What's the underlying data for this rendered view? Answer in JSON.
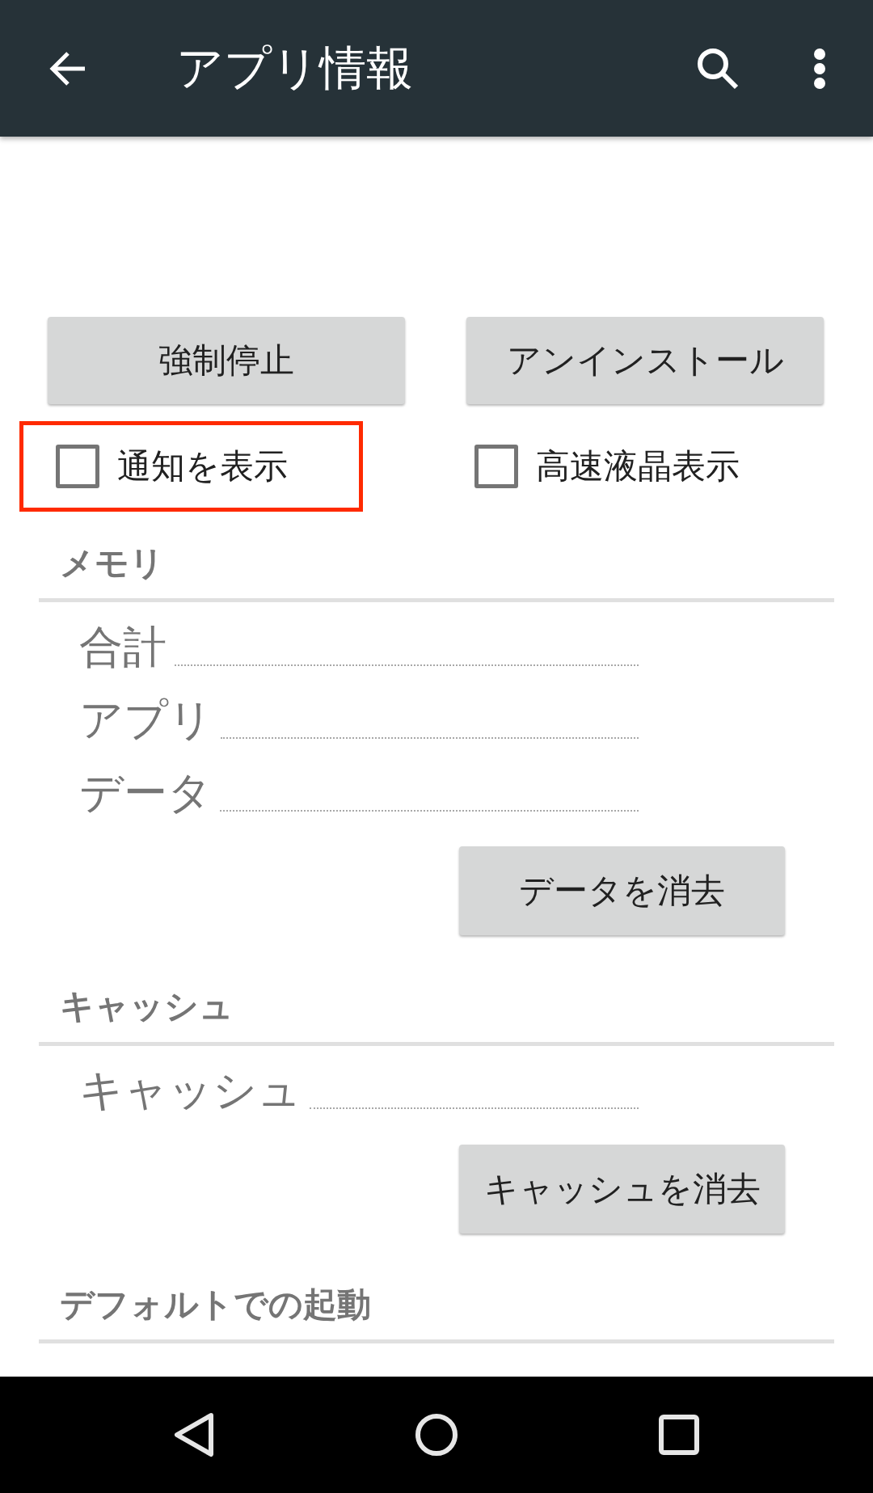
{
  "app_bar": {
    "title": "アプリ情報"
  },
  "buttons": [
    {
      "label": "強制停止"
    },
    {
      "label": "アンインストール"
    }
  ],
  "checkboxes": [
    {
      "label": "通知を表示",
      "checked": false,
      "highlighted": true
    },
    {
      "label": "高速液晶表示",
      "checked": false,
      "highlighted": false
    }
  ],
  "sections": [
    {
      "title": "メモリ",
      "rows": [
        {
          "label": "合計"
        },
        {
          "label": "アプリ"
        },
        {
          "label": "データ"
        }
      ],
      "button": "データを消去"
    },
    {
      "title": "キャッシュ",
      "rows": [
        {
          "label": "キャッシュ"
        }
      ],
      "button": "キャッシュを消去"
    },
    {
      "title": "デフォルトでの起動"
    }
  ]
}
